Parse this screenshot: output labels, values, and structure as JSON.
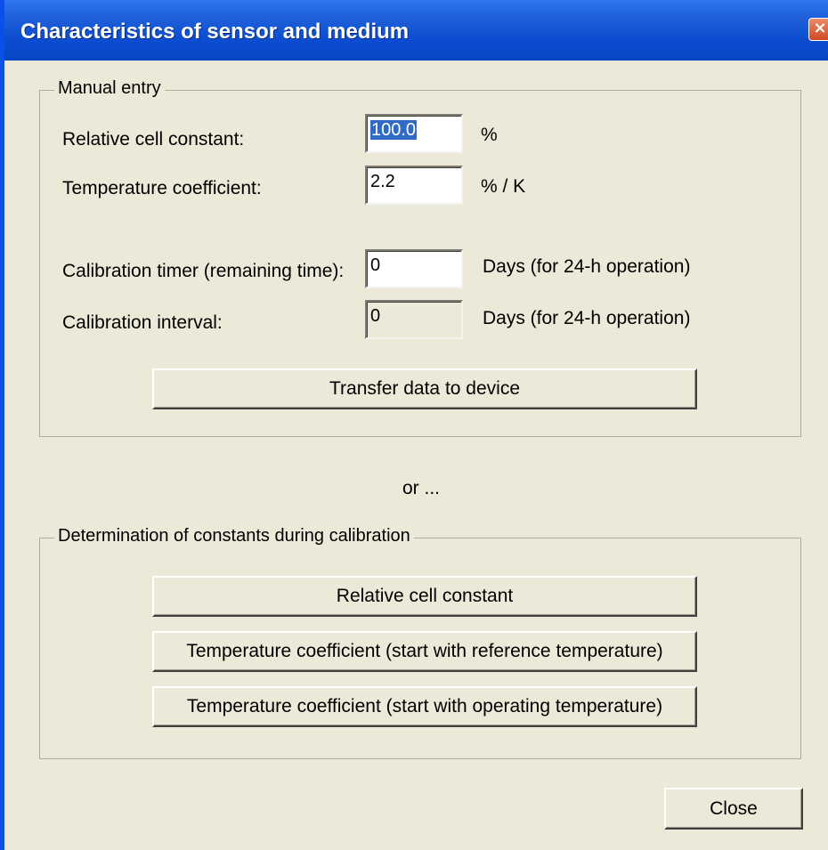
{
  "window": {
    "title": "Characteristics of sensor and medium",
    "close_glyph": "×",
    "title_bar_color": "#0a4bd0"
  },
  "manual_entry": {
    "legend": "Manual entry",
    "relative_cell_constant": {
      "label": "Relative cell constant:",
      "value": "100.0",
      "unit": "%"
    },
    "temperature_coefficient": {
      "label": "Temperature coefficient:",
      "value": "2.2",
      "unit": "% / K"
    },
    "calibration_timer": {
      "label": "Calibration timer (remaining time):",
      "value": "0",
      "unit": "Days (for 24-h operation)"
    },
    "calibration_interval": {
      "label": "Calibration interval:",
      "value": "0",
      "unit": "Days (for 24-h operation)"
    },
    "transfer_button": "Transfer data to device"
  },
  "separator_text": "or ...",
  "calibration": {
    "legend": "Determination of constants during calibration",
    "buttons": [
      "Relative cell constant",
      "Temperature coefficient (start with reference temperature)",
      "Temperature coefficient (start with operating temperature)"
    ]
  },
  "close_button": "Close"
}
